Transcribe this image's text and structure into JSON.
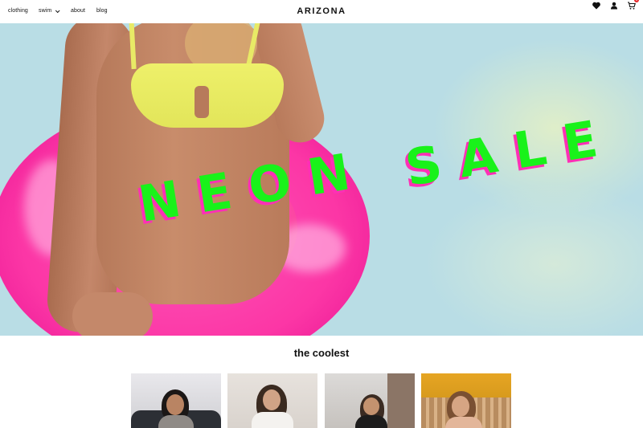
{
  "header": {
    "brand": "ARIZONA",
    "nav": [
      {
        "label": "clothing"
      },
      {
        "label": "swim"
      },
      {
        "label": "about"
      },
      {
        "label": "blog"
      }
    ],
    "icons": [
      "heart-icon",
      "user-icon",
      "cart-icon"
    ],
    "cart_count": "0"
  },
  "hero": {
    "line1": "NEON",
    "line2": "SALE",
    "colors": {
      "text": "#19f21a",
      "shadow": "#ff2fb6",
      "sky": "#b9dde5",
      "float": "#ff2da2"
    }
  },
  "section": {
    "title": "the coolest"
  },
  "products": [
    {
      "name": "product-1"
    },
    {
      "name": "product-2"
    },
    {
      "name": "product-3"
    },
    {
      "name": "product-4"
    }
  ]
}
